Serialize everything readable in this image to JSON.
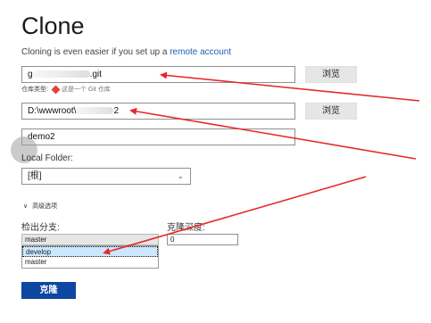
{
  "header": {
    "title": "Clone",
    "subtitle_prefix": "Cloning is even easier if you set up a ",
    "subtitle_link": "remote account"
  },
  "url_field": {
    "value_prefix": "g",
    "value_suffix": ".git"
  },
  "browse_label": "浏览",
  "repo_type": {
    "label": "仓库类型:",
    "description": "这是一个 Git 仓库",
    "icon": "git-diamond-icon",
    "icon_color": "#e34234"
  },
  "path_field": {
    "value_prefix": "D:\\wwwroot\\",
    "value_suffix": "2"
  },
  "name_field": {
    "value": "demo2"
  },
  "local_folder": {
    "label": "Local Folder:",
    "selected": "[根]"
  },
  "advanced": {
    "label": "高级选项"
  },
  "branch": {
    "label": "检出分支:",
    "selected": "master",
    "options": [
      "develop",
      "master"
    ]
  },
  "depth": {
    "label": "克隆深度:",
    "value": "0"
  },
  "clone_button": {
    "label": "克隆",
    "color": "#0d47a1"
  },
  "annotation_color": "#e8282b"
}
